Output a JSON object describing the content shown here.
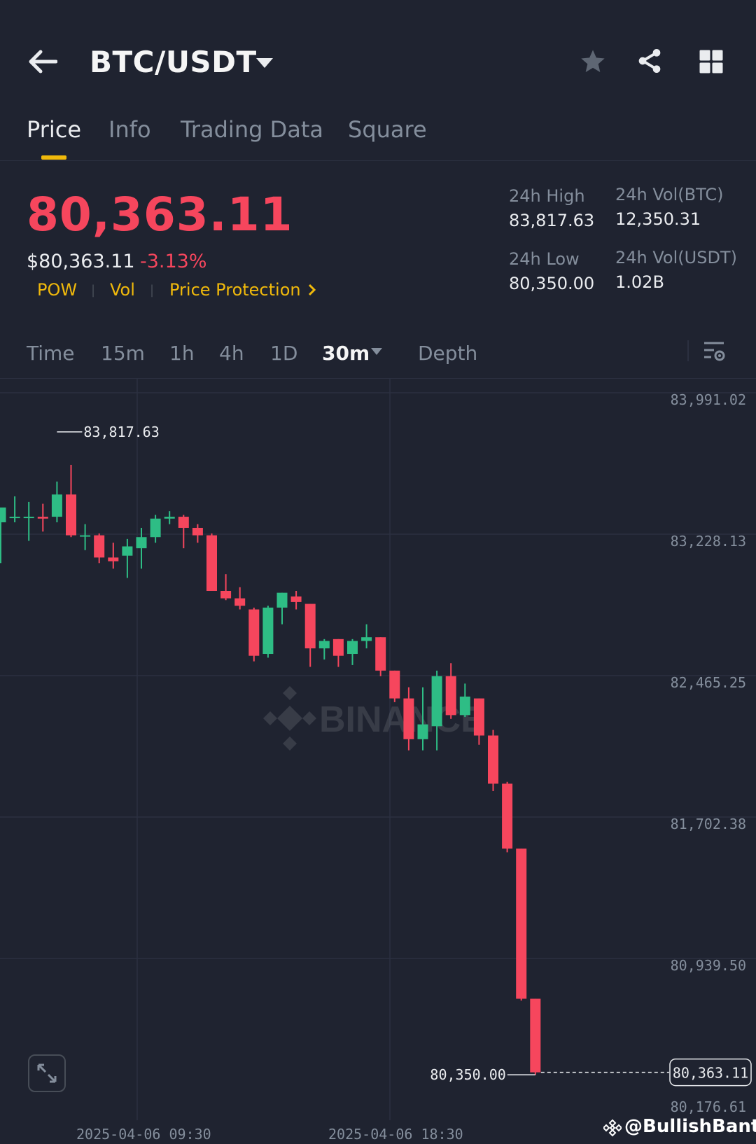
{
  "header": {
    "pair": "BTC/USDT",
    "icons": [
      "back-arrow-icon",
      "dropdown-caret-icon",
      "star-icon",
      "share-icon",
      "grid-icon"
    ]
  },
  "tabs": [
    {
      "label": "Price",
      "active": true
    },
    {
      "label": "Info",
      "active": false
    },
    {
      "label": "Trading Data",
      "active": false
    },
    {
      "label": "Square",
      "active": false
    }
  ],
  "ticker": {
    "last_price": "80,363.11",
    "usd_price": "$80,363.11",
    "change": "-3.13%",
    "tags": [
      "POW",
      "Vol",
      "Price Protection"
    ],
    "stats": {
      "high_label": "24h High",
      "high": "83,817.63",
      "low_label": "24h Low",
      "low": "80,350.00",
      "vol_btc_label": "24h Vol(BTC)",
      "vol_btc": "12,350.31",
      "vol_usdt_label": "24h Vol(USDT)",
      "vol_usdt": "1.02B"
    }
  },
  "intervals": [
    {
      "label": "Time",
      "active": false
    },
    {
      "label": "15m",
      "active": false
    },
    {
      "label": "1h",
      "active": false
    },
    {
      "label": "4h",
      "active": false
    },
    {
      "label": "1D",
      "active": false
    },
    {
      "label": "30m",
      "active": true
    },
    {
      "label": "Depth",
      "active": false
    }
  ],
  "colors": {
    "up": "#2ebd85",
    "down": "#f6465d",
    "accent": "#f0b90b",
    "bg": "#1f2330"
  },
  "chart_data": {
    "type": "candlestick",
    "y_ticks": [
      "83,991.02",
      "83,228.13",
      "82,465.25",
      "81,702.38",
      "80,939.50",
      "80,176.61"
    ],
    "x_ticks": [
      "2025-04-06 09:30",
      "2025-04-06 18:30"
    ],
    "ylim": [
      80176.61,
      83991.02
    ],
    "high_marker": "83,817.63",
    "low_marker": "80,350.00",
    "last_marker": "80,363.11",
    "watermark": "BINANCE",
    "candles": [
      {
        "o": 83330,
        "h": 83400,
        "l": 83110,
        "c": 83410
      },
      {
        "o": 83360,
        "h": 83470,
        "l": 83330,
        "c": 83360
      },
      {
        "o": 83360,
        "h": 83440,
        "l": 83230,
        "c": 83360
      },
      {
        "o": 83360,
        "h": 83430,
        "l": 83280,
        "c": 83350
      },
      {
        "o": 83360,
        "h": 83550,
        "l": 83330,
        "c": 83480
      },
      {
        "o": 83480,
        "h": 83640,
        "l": 83250,
        "c": 83260
      },
      {
        "o": 83260,
        "h": 83320,
        "l": 83180,
        "c": 83260
      },
      {
        "o": 83260,
        "h": 83270,
        "l": 83110,
        "c": 83140
      },
      {
        "o": 83140,
        "h": 83220,
        "l": 83080,
        "c": 83120
      },
      {
        "o": 83150,
        "h": 83240,
        "l": 83030,
        "c": 83200
      },
      {
        "o": 83190,
        "h": 83300,
        "l": 83080,
        "c": 83250
      },
      {
        "o": 83250,
        "h": 83370,
        "l": 83220,
        "c": 83350
      },
      {
        "o": 83350,
        "h": 83390,
        "l": 83320,
        "c": 83360
      },
      {
        "o": 83360,
        "h": 83370,
        "l": 83190,
        "c": 83300
      },
      {
        "o": 83300,
        "h": 83320,
        "l": 83220,
        "c": 83260
      },
      {
        "o": 83260,
        "h": 83270,
        "l": 82960,
        "c": 82960
      },
      {
        "o": 82960,
        "h": 83050,
        "l": 82910,
        "c": 82920
      },
      {
        "o": 82920,
        "h": 82980,
        "l": 82860,
        "c": 82880
      },
      {
        "o": 82860,
        "h": 82870,
        "l": 82580,
        "c": 82610
      },
      {
        "o": 82620,
        "h": 82880,
        "l": 82600,
        "c": 82870
      },
      {
        "o": 82870,
        "h": 82950,
        "l": 82780,
        "c": 82950
      },
      {
        "o": 82930,
        "h": 82960,
        "l": 82860,
        "c": 82900
      },
      {
        "o": 82890,
        "h": 82890,
        "l": 82550,
        "c": 82650
      },
      {
        "o": 82650,
        "h": 82700,
        "l": 82590,
        "c": 82690
      },
      {
        "o": 82700,
        "h": 82700,
        "l": 82550,
        "c": 82610
      },
      {
        "o": 82620,
        "h": 82700,
        "l": 82560,
        "c": 82690
      },
      {
        "o": 82690,
        "h": 82780,
        "l": 82650,
        "c": 82710
      },
      {
        "o": 82710,
        "h": 82710,
        "l": 82500,
        "c": 82530
      },
      {
        "o": 82530,
        "h": 82530,
        "l": 82360,
        "c": 82380
      },
      {
        "o": 82380,
        "h": 82440,
        "l": 82100,
        "c": 82160
      },
      {
        "o": 82160,
        "h": 82440,
        "l": 82100,
        "c": 82240
      },
      {
        "o": 82230,
        "h": 82530,
        "l": 82100,
        "c": 82500
      },
      {
        "o": 82500,
        "h": 82570,
        "l": 82270,
        "c": 82290
      },
      {
        "o": 82290,
        "h": 82460,
        "l": 82280,
        "c": 82390
      },
      {
        "o": 82380,
        "h": 82380,
        "l": 82130,
        "c": 82180
      },
      {
        "o": 82180,
        "h": 82210,
        "l": 81880,
        "c": 81920
      },
      {
        "o": 81920,
        "h": 81930,
        "l": 81550,
        "c": 81570
      },
      {
        "o": 81570,
        "h": 81570,
        "l": 80750,
        "c": 80760
      },
      {
        "o": 80760,
        "h": 80760,
        "l": 80350,
        "c": 80363
      }
    ]
  },
  "credit": "@BullishBanter"
}
